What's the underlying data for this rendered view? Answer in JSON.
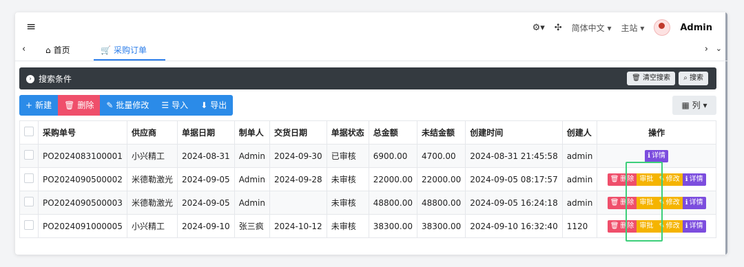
{
  "topbar": {
    "theme_icon": "⚙",
    "lang": "简体中文",
    "station": "主站",
    "user": "Admin"
  },
  "tabs": {
    "home": "首页",
    "active": "采购订单"
  },
  "search": {
    "title": "搜索条件",
    "clear_label": "清空搜索",
    "search_label": "搜索"
  },
  "toolbar": {
    "new_label": "新建",
    "delete_label": "删除",
    "batch_label": "批量修改",
    "import_label": "导入",
    "export_label": "导出",
    "columns_label": "列"
  },
  "table": {
    "headers": [
      "采购单号",
      "供应商",
      "单据日期",
      "制单人",
      "交货日期",
      "单据状态",
      "总金额",
      "未结金额",
      "创建时间",
      "创建人",
      "操作"
    ],
    "rows": [
      {
        "no": "PO2024083100001",
        "supplier": "小兴精工",
        "date": "2024-08-31",
        "maker": "Admin",
        "delivery": "2024-09-30",
        "status": "已审核",
        "total": "6900.00",
        "unpaid": "4700.00",
        "created": "2024-08-31 21:45:58",
        "creator": "admin"
      },
      {
        "no": "PO2024090500002",
        "supplier": "米德勒激光",
        "date": "2024-09-05",
        "maker": "Admin",
        "delivery": "2024-09-28",
        "status": "未审核",
        "total": "22000.00",
        "unpaid": "22000.00",
        "created": "2024-09-05 08:17:57",
        "creator": "admin"
      },
      {
        "no": "PO2024090500003",
        "supplier": "米德勒激光",
        "date": "2024-09-05",
        "maker": "Admin",
        "delivery": "",
        "status": "未审核",
        "total": "48800.00",
        "unpaid": "48800.00",
        "created": "2024-09-05 16:24:18",
        "creator": "admin"
      },
      {
        "no": "PO2024091000005",
        "supplier": "小兴精工",
        "date": "2024-09-10",
        "maker": "张三疯",
        "delivery": "2024-10-12",
        "status": "未审核",
        "total": "38300.00",
        "unpaid": "38300.00",
        "created": "2024-09-10 16:32:40",
        "creator": "1120"
      }
    ],
    "ops": {
      "delete": "删除",
      "approve": "审批",
      "edit": "修改",
      "detail": "详情"
    }
  },
  "colors": {
    "primary": "#2b8be8",
    "danger": "#ef4f6b",
    "warning": "#f5b400",
    "purple": "#7c4dde",
    "dark": "#343a40",
    "highlight": "#3ccf7a"
  }
}
